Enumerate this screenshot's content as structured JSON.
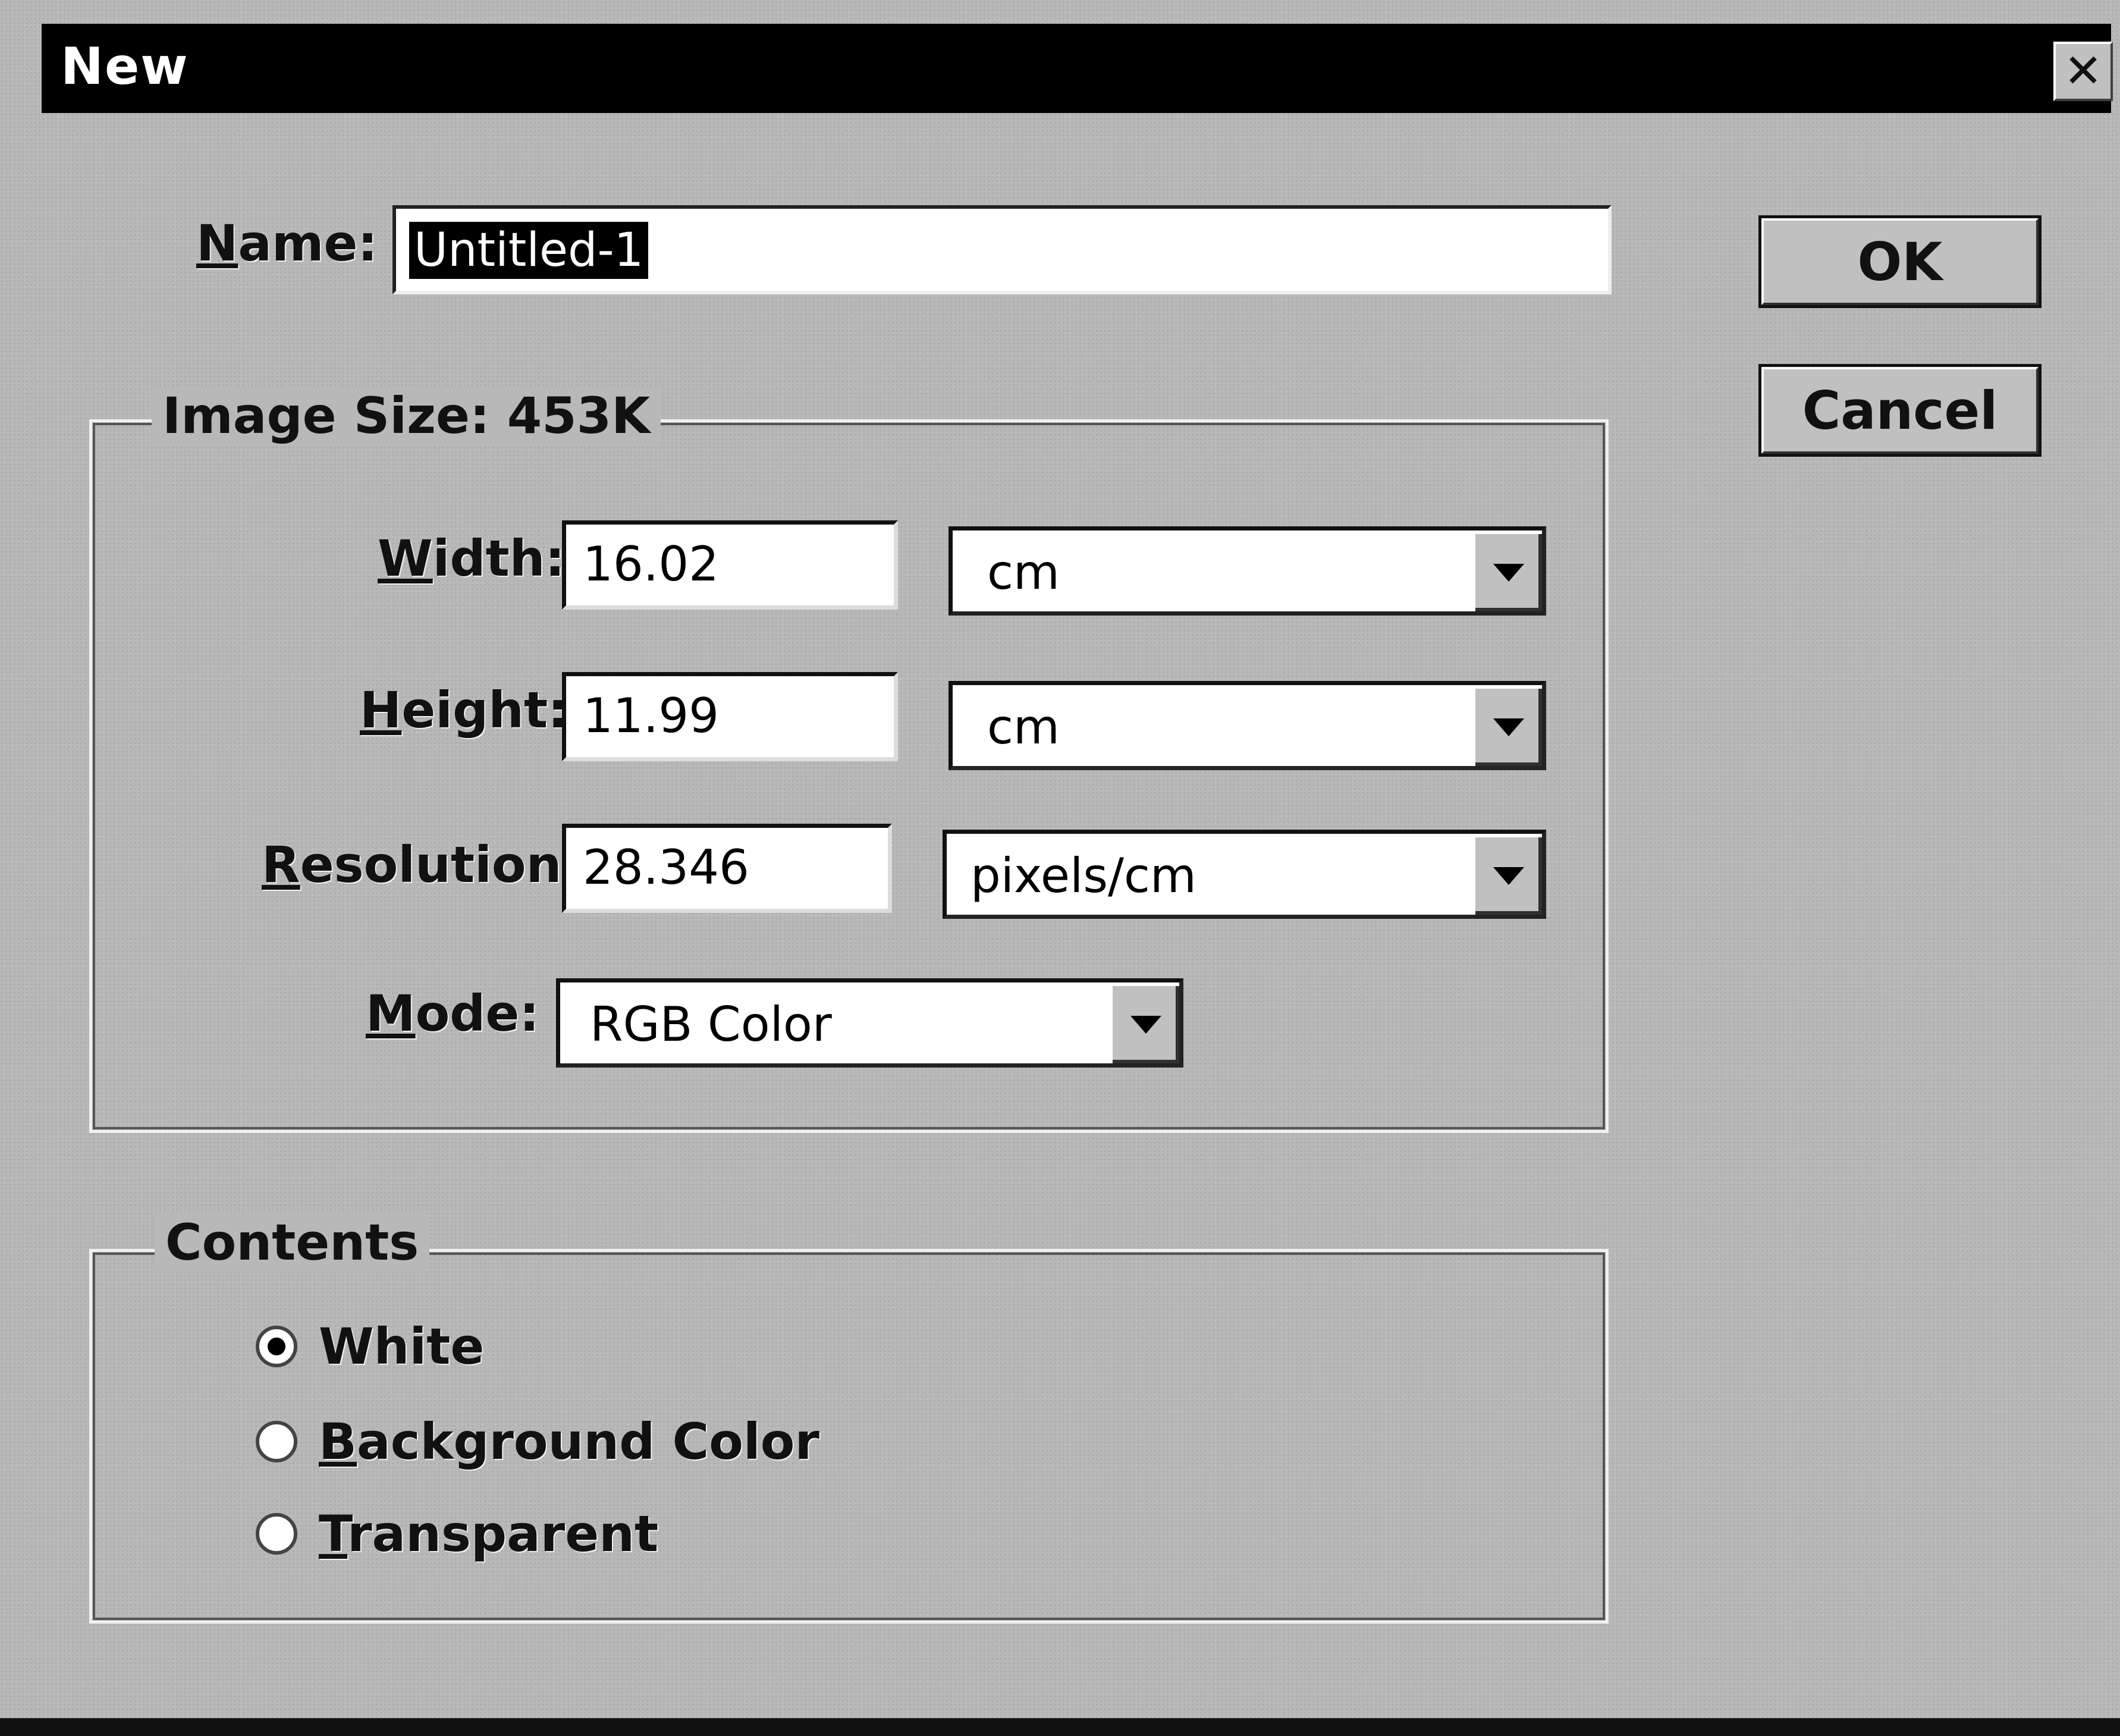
{
  "dialog": {
    "title": "New",
    "close_glyph": "✕"
  },
  "name": {
    "label_first": "N",
    "label_rest": "ame:",
    "value": "Untitled-1"
  },
  "buttons": {
    "ok": "OK",
    "cancel": "Cancel"
  },
  "image_size": {
    "title": "Image Size: 453K",
    "width": {
      "label_first": "W",
      "label_rest": "idth:",
      "value": "16.02",
      "unit": "cm"
    },
    "height": {
      "label_first": "H",
      "label_rest": "eight:",
      "value": "11.99",
      "unit": "cm"
    },
    "resolution": {
      "label_first": "R",
      "label_rest": "esolution:",
      "value": "28.346",
      "unit": "pixels/cm"
    },
    "mode": {
      "label_first": "M",
      "label_rest": "ode:",
      "value": "RGB Color"
    }
  },
  "contents": {
    "title": "Contents",
    "options": [
      {
        "label": "White",
        "checked": true
      },
      {
        "label_first": "B",
        "label_rest": "ackground Color",
        "checked": false
      },
      {
        "label_first": "T",
        "label_rest": "ransparent",
        "checked": false
      }
    ]
  }
}
